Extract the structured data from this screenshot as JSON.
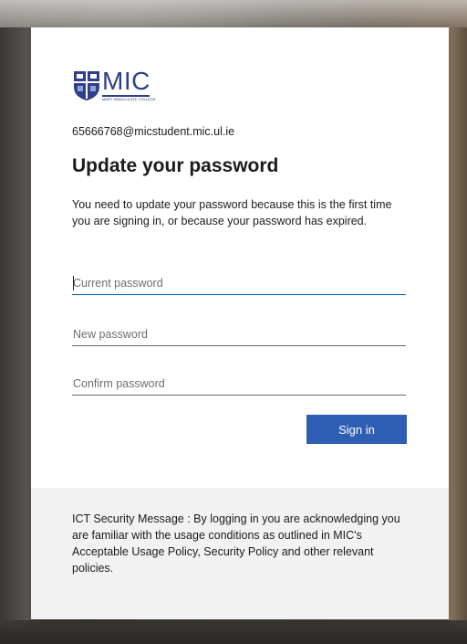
{
  "brand": {
    "logo_text": "MIC",
    "logo_subtext": "MARY IMMACULATE COLLEGE",
    "crest_icon": "college-crest-icon",
    "color": "#2f3f8a"
  },
  "account": {
    "email": "65666768@micstudent.mic.ul.ie"
  },
  "page": {
    "title": "Update your password",
    "description": "You need to update your password because this is the first time you are signing in, or because your password has expired."
  },
  "form": {
    "current_password_placeholder": "Current password",
    "new_password_placeholder": "New password",
    "confirm_password_placeholder": "Confirm password",
    "submit_label": "Sign in",
    "accent_color": "#2f5fb4"
  },
  "footer": {
    "security_message": "ICT Security Message : By logging in you are acknowledging you are familiar with the usage conditions as outlined in MIC's Acceptable Usage Policy, Security Policy and other relevant policies."
  }
}
